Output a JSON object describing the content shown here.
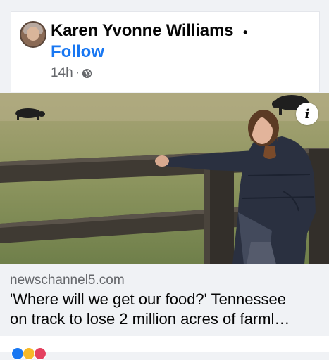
{
  "post": {
    "author": "Karen Yvonne Williams",
    "separator": "•",
    "follow_label": "Follow",
    "time": "14h",
    "time_separator": "·",
    "privacy_icon": "globe-icon"
  },
  "image": {
    "info_icon": "info-icon",
    "info_label": "i"
  },
  "link": {
    "domain": "newschannel5.com",
    "headline_line1": "'Where will we get our food?' Tennessee",
    "headline_line2": "on track to lose 2 million acres of farml…"
  },
  "reactions": {
    "icons": [
      "like-icon",
      "love-icon",
      "haha-icon"
    ]
  },
  "colors": {
    "brand": "#1877f2",
    "text": "#050505",
    "muted": "#65676b"
  }
}
